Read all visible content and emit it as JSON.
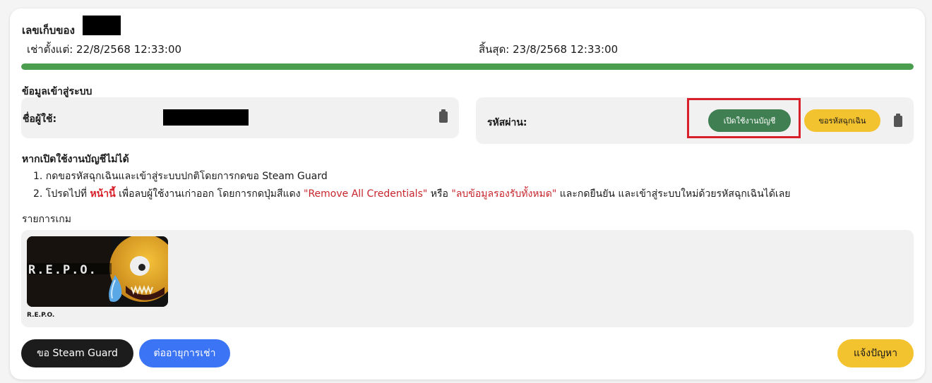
{
  "rental": {
    "title": "เลขเก็บของ",
    "start_label": "เช่าตั้งแต่: 22/8/2568 12:33:00",
    "end_label": "สิ้นสุด: 23/8/2568 12:33:00",
    "progress": 1.0
  },
  "login": {
    "section_title": "ข้อมูลเข้าสู่ระบบ",
    "username_label": "ชื่อผู้ใช้:",
    "password_label": "รหัสผ่าน:",
    "enable_account_button": "เปิดใช้งานบัญชี",
    "emergency_code_button": "ขอรหัสฉุกเฉิน"
  },
  "help": {
    "title": "หากเปิดใช้งานบัญชีไม่ได้",
    "item1": "1. กดขอรหัสฉุกเฉินและเข้าสู่ระบบปกติโดยการกดขอ Steam Guard",
    "item2_prefix": "2. โปรดไปที่ ",
    "item2_link": "หน้านี้",
    "item2_mid1": " เพื่อลบผู้ใช้งานเก่าออก โดยการกดปุ่มสีแดง ",
    "item2_red1": "\"Remove All Credentials\"",
    "item2_mid2": " หรือ ",
    "item2_red2": "\"ลบข้อมูลรองรับทั้งหมด\"",
    "item2_suffix": " และกดยืนยัน และเข้าสู่ระบบใหม่ด้วยรหัสฉุกเฉินได้เลย"
  },
  "games": {
    "title": "รายการเกม",
    "items": [
      {
        "name": "R.E.P.O.",
        "logo_text": "R.E.P.O."
      }
    ]
  },
  "actions": {
    "steam_guard_button": "ขอ Steam Guard",
    "extend_button": "ต่ออายุการเช่า",
    "report_button": "แจ้งปัญหา"
  },
  "colors": {
    "progress": "#4a9e4d",
    "enable_button": "#3f7f52",
    "emergency_button": "#f3c22f",
    "steam_guard_button": "#1c1c1c",
    "extend_button": "#3b74f5",
    "report_button": "#f3c22f",
    "highlight_frame": "#d8202a"
  }
}
